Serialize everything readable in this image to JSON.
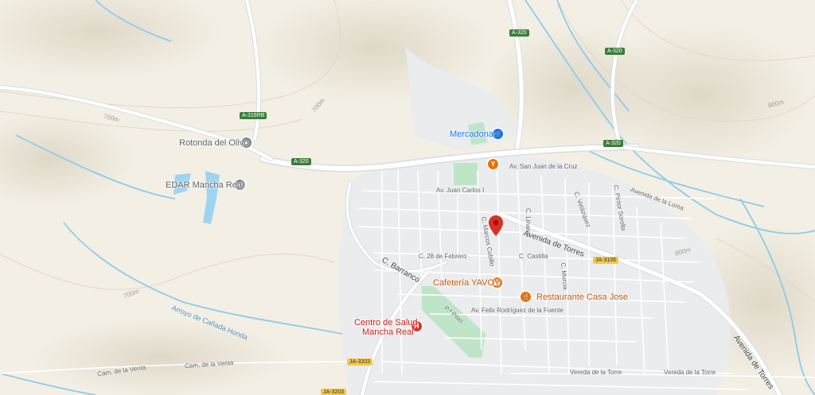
{
  "map": {
    "pois": [
      {
        "id": "rotonda",
        "label": "Rotonda del Olivo",
        "icon": "gray-place-icon"
      },
      {
        "id": "edar",
        "label": "EDAR Mancha Real",
        "icon": "gray-place-icon"
      },
      {
        "id": "mercadona",
        "label": "Mercadona",
        "icon": "shopping-cart-icon"
      },
      {
        "id": "cafeteria",
        "label": "Cafetería YAVOY",
        "icon": "cafe-icon"
      },
      {
        "id": "restaurante",
        "label": "Restaurante Casa Jose",
        "icon": "restaurant-icon"
      },
      {
        "id": "centro",
        "label_line1": "Centro de Salud",
        "label_line2": "Mancha Real",
        "icon": "hospital-icon"
      }
    ],
    "streets": {
      "av_san_juan": "Av. San Juan de la Cruz",
      "av_juan_carlos": "Av. Juan Carlos I",
      "c_linares": "C. Linares",
      "c_velazquez": "C. Velázquez",
      "c_pintor": "C. Pintor Sorolla",
      "avenida_torres": "Avenida de Torres",
      "avenida_torres_2": "Avenida de Torres",
      "c_marcos": "C. Marcos Cubillo",
      "c_28": "C. 28 de Febrero",
      "c_castilla": "C. Castilla",
      "c_murcia": "C. Murcia",
      "c_barranco": "C. Barranco",
      "av_felix": "Av. Felix Rodríguez de la Fuente",
      "p_pilas": "P.ª Pilas",
      "cam_venta_1": "Cam. de la Venta",
      "cam_venta_2": "Cam. de la Venta",
      "vereda_1": "Vereda de la Torre",
      "vereda_2": "Vereda de la Torre",
      "avenida_loma": "Avenida de la Loma"
    },
    "roads": {
      "a320_top": "A-320",
      "a320_right": "A-320",
      "a320_mid": "A-320",
      "a320_left": "A-320",
      "a316": "A-316RB",
      "ja3106": "JA-3106",
      "ja3203": "JA-3203",
      "ja3203b": "JA-3203"
    },
    "water": {
      "arroyo": "Arroyo de Cañada Honda"
    },
    "contours": [
      "700m",
      "700m",
      "800m",
      "700m",
      "800m"
    ],
    "colors": {
      "land": "#f3efe4",
      "urban": "#ebecee",
      "park": "#bfe5c8",
      "water": "#9fd4ef",
      "road": "#ffffff",
      "highway": "#dadce0",
      "pin": "#d93025"
    }
  }
}
